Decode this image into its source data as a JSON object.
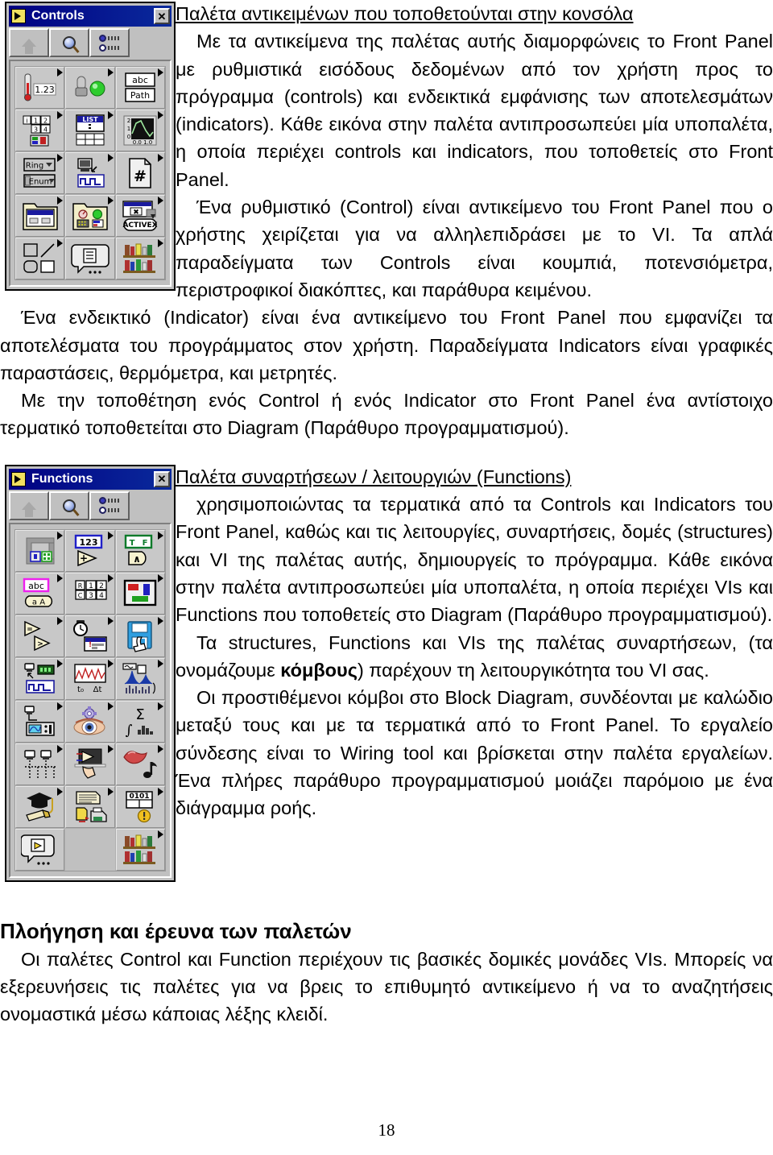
{
  "document": {
    "page_number": "18",
    "language": "el"
  },
  "section_controls": {
    "heading": "Παλέτα αντικειμένων που τοποθετούνται στην κονσόλα",
    "paragraphs": [
      "Με τα αντικείμενα της παλέτας αυτής διαμορφώνεις το Front Panel με ρυθμιστικά εισόδους δεδομένων από τον χρήστη προς το πρόγραμμα (controls) και ενδεικτικά εμφάνισης των αποτελεσμάτων (indicators). Κάθε εικόνα στην παλέτα αντιπροσωπεύει μία υποπαλέτα, η οποία περιέχει controls και indicators, που τοποθετείς στο Front Panel.",
      "Ένα ρυθμιστικό (Control) είναι αντικείμενο του Front Panel που ο χρήστης χειρίζεται για να αλληλεπιδράσει με το VI. Τα απλά παραδείγματα των Controls είναι κουμπιά, ποτενσιόμετρα, περιστροφικοί διακόπτες, και παράθυρα κειμένου.",
      "Ένα ενδεικτικό (Indicator) είναι ένα αντικείμενο του Front Panel που εμφανίζει τα αποτελέσματα του προγράμματος στον χρήστη. Παραδείγματα Indicators είναι γραφικές παραστάσεις, θερμόμετρα, και μετρητές.",
      "Με την τοποθέτηση ενός Control ή ενός Indicator στο Front Panel ένα αντίστοιχο τερματικό τοποθετείται στο Diagram (Παράθυρο προγραμματισμού)."
    ]
  },
  "section_functions": {
    "heading": "Παλέτα συναρτήσεων / λειτουργιών (Functions)",
    "paragraphs": [
      "χρησιμοποιώντας τα τερματικά από τα Controls και Indicators του Front Panel, καθώς και τις λειτουργίες, συναρτήσεις, δομές (structures) και VI της παλέτας αυτής, δημιουργείς το πρόγραμμα. Κάθε εικόνα στην παλέτα  αντιπροσωπεύει μία υποπαλέτα, η οποία περιέχει  VIs και Functions που τοποθετείς στο Diagram (Παράθυρο προγραμματισμού).",
      "Τα structures, Functions και VIs  της παλέτας συναρτήσεων, (τα ονομάζουμε κόμβους) παρέχουν τη λειτουργικότητα του VI σας.",
      "Οι προστιθέμενοι κόμβοι στο Block Diagram, συνδέονται με καλώδιο μεταξύ τους και με τα τερματικά από το Front Panel. Το εργαλείο σύνδεσης είναι το Wiring tool και βρίσκεται στην παλέτα εργαλείων. Ένα πλήρες παράθυρο προγραμματισμού μοιάζει παρόμοιο με ένα διάγραμμα ροής."
    ],
    "bold_term": "κόμβους"
  },
  "section_navigation": {
    "heading": "Πλοήγηση και έρευνα των παλετών",
    "paragraphs": [
      "Οι παλέτες Control και Function περιέχουν τις βασικές δομικές μονάδες VIs. Μπορείς να εξερευνήσεις τις παλέτες για να βρεις το επιθυμητό αντικείμενο ή να το αναζητήσεις ονομαστικά μέσω κάποιας λέξης κλειδί."
    ]
  },
  "controls_palette": {
    "title": "Controls",
    "close_label": "✕",
    "toolbar": [
      {
        "name": "up-one-level",
        "icon": "up-arrow-icon"
      },
      {
        "name": "search",
        "icon": "magnifier-icon"
      },
      {
        "name": "view-options",
        "icon": "radio-list-icon"
      }
    ],
    "cells": [
      "numeric",
      "boolean",
      "string-and-path",
      "array-and-cluster",
      "list-and-table",
      "graph",
      "ring-and-enum",
      "io",
      "refnum",
      "dialog-controls",
      "classic-controls",
      "activex",
      "decorations",
      "select-control",
      "user-controls"
    ],
    "cell_labels": {
      "numeric_value": "1.23",
      "string": "abc",
      "path": "Path",
      "array": "1 2 3 4",
      "list": "LIST",
      "graph_axis": "0.0 1.0",
      "graph_y": "2 1 0",
      "ring": "Ring",
      "enum": "Enum",
      "refnum": "#",
      "activex": "ACTIVEX"
    }
  },
  "functions_palette": {
    "title": "Functions",
    "close_label": "✕",
    "toolbar": [
      {
        "name": "up-one-level",
        "icon": "up-arrow-icon"
      },
      {
        "name": "search",
        "icon": "magnifier-icon"
      },
      {
        "name": "view-options",
        "icon": "radio-list-icon"
      }
    ],
    "cells": [
      "structures",
      "numeric",
      "boolean",
      "string",
      "array-and-cluster",
      "comparison",
      "comparison-2",
      "time-and-dialog",
      "file-io",
      "data-acquisition",
      "waveform",
      "analyze",
      "instrument-io",
      "motion-and-vision",
      "mathematics",
      "communication",
      "application-control",
      "graphics-and-sound",
      "tutorial",
      "report-generation",
      "advanced",
      "select-vi",
      "empty",
      "user-libraries"
    ],
    "cell_labels": {
      "numeric": "123",
      "boolean": "T F",
      "string": "abc",
      "string_case": "a A",
      "array_rc": "R C",
      "array_nums": "1 2 3 4",
      "waveform_t0": "t₀",
      "waveform_dt": "Δt",
      "math_sigma": "Σ",
      "math_integral": "∫",
      "advanced_bits": "0101"
    }
  }
}
